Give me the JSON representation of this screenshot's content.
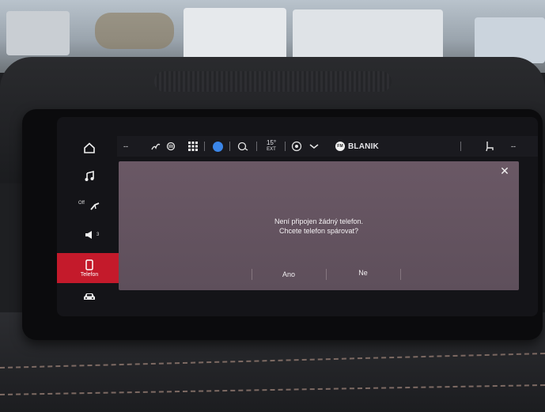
{
  "rail": {
    "fan_label": "Off",
    "volume_level": "3",
    "phone_label": "Telefon"
  },
  "statusbar": {
    "left_dash": "--",
    "temp_value": "15°",
    "temp_unit": "EXT",
    "radio_badge": "FM",
    "radio_station": "BLANIK",
    "right_dash": "--"
  },
  "dialog": {
    "line1": "Není připojen žádný telefon.",
    "line2": "Chcete telefon spárovat?",
    "yes_label": "Ano",
    "no_label": "Ne",
    "close_glyph": "✕"
  },
  "colors": {
    "accent_red": "#c41a2b",
    "profile_blue": "#3b86e8",
    "dialog_bg": "#62525e"
  }
}
